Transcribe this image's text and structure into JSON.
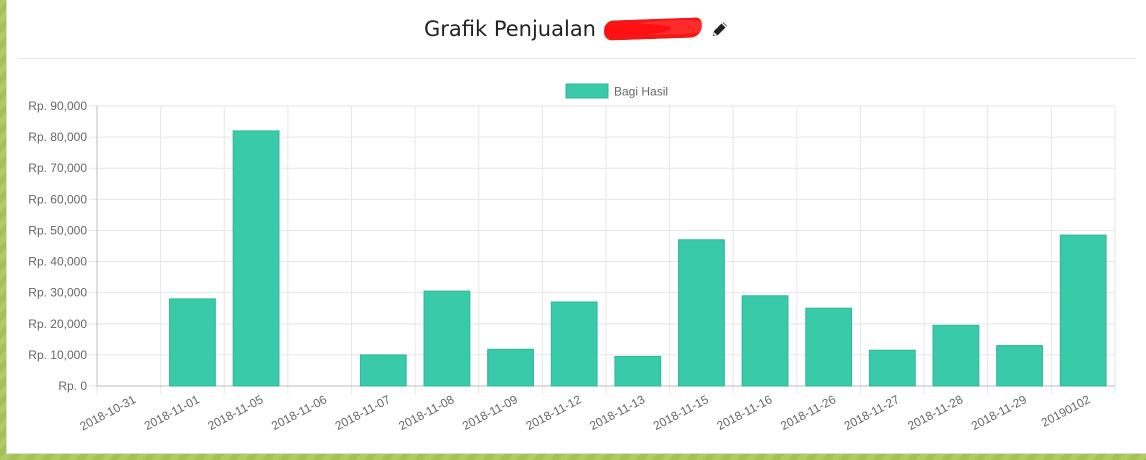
{
  "panel": {
    "title": "Grafik Penjualan"
  },
  "icons": {
    "edit": "pencil-icon"
  },
  "colors": {
    "bar": "#38caa9",
    "bar_border": "#2fb798",
    "grid": "#e6e6e6",
    "axis_text": "#666666"
  },
  "chart_data": {
    "type": "bar",
    "legend": {
      "position": "top",
      "entries": [
        "Bagi Hasil"
      ]
    },
    "categories": [
      "2018-10-31",
      "2018-11-01",
      "2018-11-05",
      "2018-11-06",
      "2018-11-07",
      "2018-11-08",
      "2018-11-09",
      "2018-11-12",
      "2018-11-13",
      "2018-11-15",
      "2018-11-16",
      "2018-11-26",
      "2018-11-27",
      "2018-11-28",
      "2018-11-29",
      "20190102"
    ],
    "series": [
      {
        "name": "Bagi Hasil",
        "values": [
          0,
          28000,
          82000,
          0,
          10000,
          30500,
          11800,
          27000,
          9500,
          47000,
          29000,
          25000,
          11500,
          19500,
          13000,
          48500
        ]
      }
    ],
    "ylim": [
      0,
      90000
    ],
    "yticks": [
      {
        "value": 0,
        "label": "Rp. 0"
      },
      {
        "value": 10000,
        "label": "Rp. 10,000"
      },
      {
        "value": 20000,
        "label": "Rp. 20,000"
      },
      {
        "value": 30000,
        "label": "Rp. 30,000"
      },
      {
        "value": 40000,
        "label": "Rp. 40,000"
      },
      {
        "value": 50000,
        "label": "Rp. 50,000"
      },
      {
        "value": 60000,
        "label": "Rp. 60,000"
      },
      {
        "value": 70000,
        "label": "Rp. 70,000"
      },
      {
        "value": 80000,
        "label": "Rp. 80,000"
      },
      {
        "value": 90000,
        "label": "Rp. 90,000"
      }
    ],
    "grid": true
  }
}
